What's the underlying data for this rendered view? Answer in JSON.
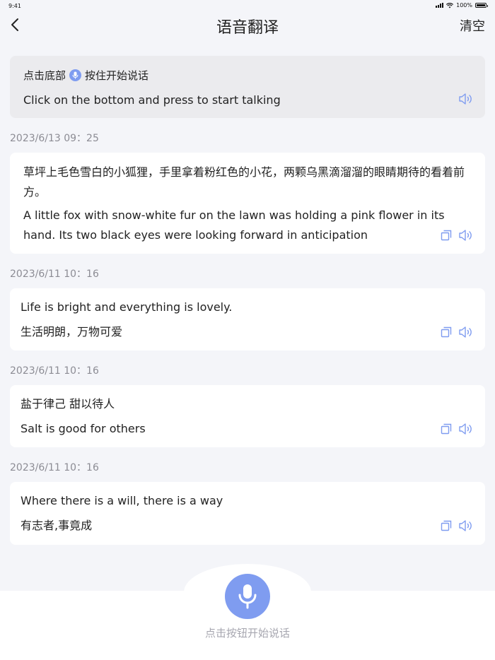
{
  "status_bar": {
    "time": "9:41",
    "battery": "100%"
  },
  "header": {
    "title": "语音翻译",
    "clear_label": "清空"
  },
  "prompt": {
    "before_icon": "点击底部",
    "after_icon": "按住开始说话",
    "english": "Click on the bottom and press to start talking"
  },
  "records": [
    {
      "timestamp": "2023/6/13   09：25",
      "source": "草坪上毛色雪白的小狐狸，手里拿着粉红色的小花，两颗乌黑滴溜溜的眼睛期待的看着前方。",
      "translation": "A little fox with snow-white fur on the lawn was holding a pink flower in its hand. Its two black eyes were looking forward in anticipation"
    },
    {
      "timestamp": "2023/6/11   10：16",
      "source": "Life is bright and everything is lovely.",
      "translation": "生活明朗，万物可爱"
    },
    {
      "timestamp": "2023/6/11   10：16",
      "source": "盐于律己 甜以待人",
      "translation": "Salt is good for others"
    },
    {
      "timestamp": "2023/6/11   10：16",
      "source": "Where there is a will, there is a way",
      "translation": "有志者,事竟成"
    }
  ],
  "footer": {
    "hint": "点击按钮开始说话"
  },
  "icons": {
    "back": "chevron-left-icon",
    "mic": "microphone-icon",
    "speaker": "speaker-icon",
    "copy": "copy-icon"
  },
  "colors": {
    "accent": "#7f9cf0",
    "background": "#f4f5f9",
    "timestamp": "#8c8c94"
  }
}
